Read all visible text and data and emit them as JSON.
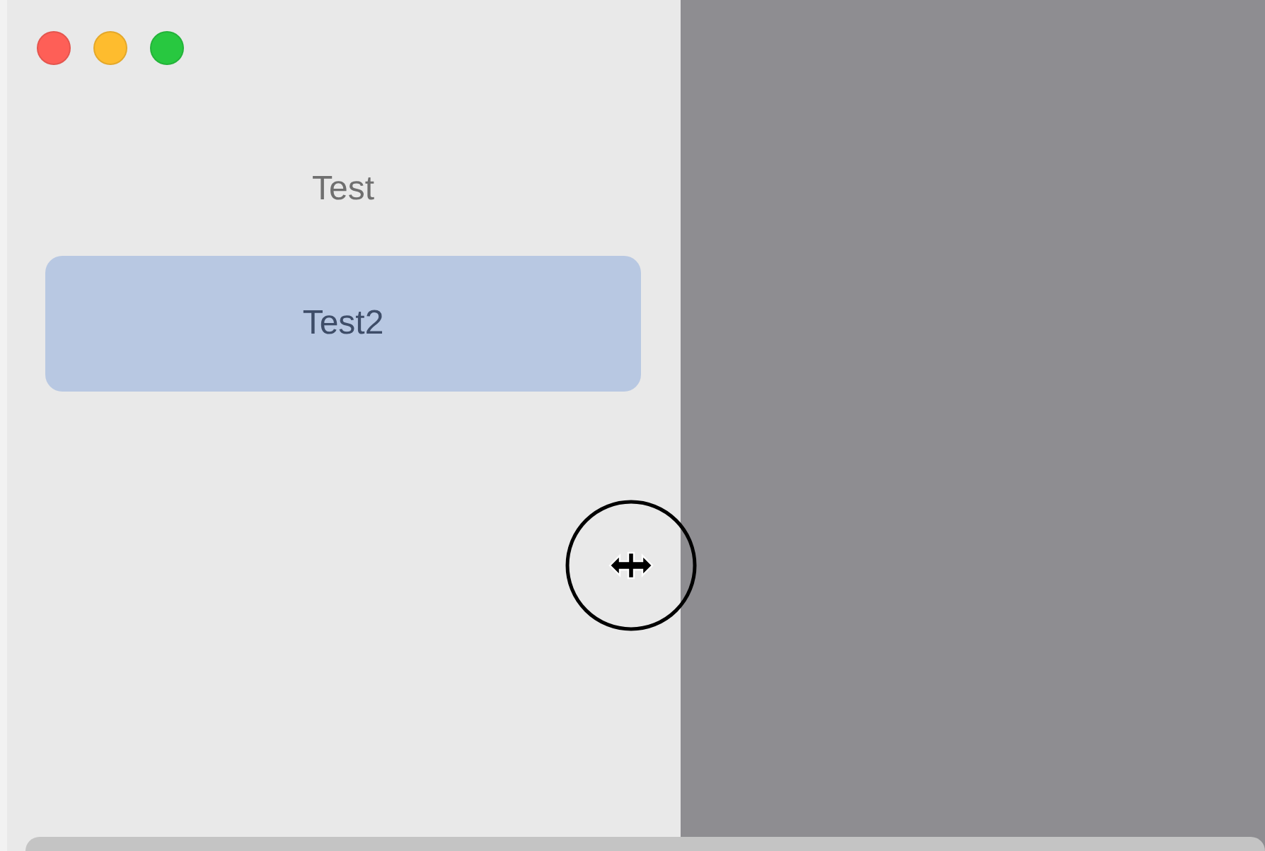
{
  "sidebar": {
    "items": [
      {
        "label": "Test",
        "selected": false
      },
      {
        "label": "Test2",
        "selected": true
      }
    ]
  }
}
